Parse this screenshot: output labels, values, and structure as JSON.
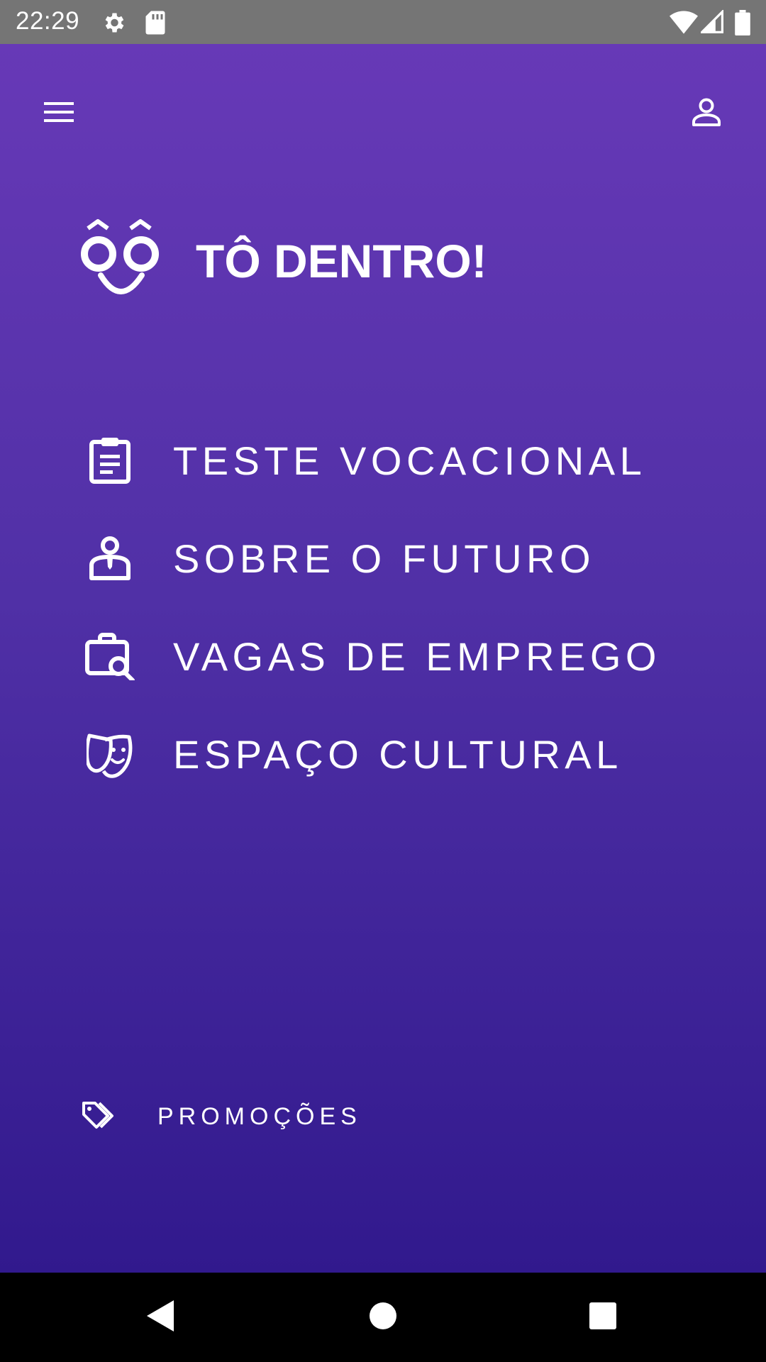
{
  "status_bar": {
    "time": "22:29",
    "icons": [
      "settings-icon",
      "sd-card-icon",
      "wifi-icon",
      "signal-icon",
      "battery-icon"
    ]
  },
  "header": {
    "menu_icon": "hamburger-menu-icon",
    "profile_icon": "person-icon"
  },
  "brand": {
    "title": "TÔ DENTRO!",
    "logo_icon": "smiling-face-logo"
  },
  "menu": {
    "items": [
      {
        "label": "TESTE VOCACIONAL",
        "icon": "clipboard-icon"
      },
      {
        "label": "SOBRE O FUTURO",
        "icon": "worker-icon"
      },
      {
        "label": "VAGAS DE EMPREGO",
        "icon": "briefcase-search-icon"
      },
      {
        "label": "ESPAÇO CULTURAL",
        "icon": "theater-mask-icon"
      }
    ]
  },
  "promo": {
    "label": "PROMOÇÕES",
    "icon": "tags-icon"
  },
  "nav_bar": {
    "icons": [
      "back-icon",
      "home-icon",
      "recents-icon"
    ]
  },
  "colors": {
    "gradient_top": "#6739b7",
    "gradient_bottom": "#31198d",
    "status_bar": "#757575",
    "text": "#ffffff"
  }
}
